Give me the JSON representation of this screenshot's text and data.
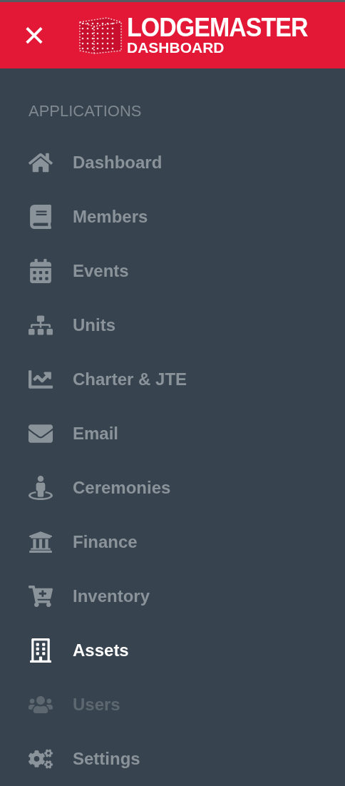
{
  "header": {
    "close": "×",
    "logo_title": "LODGEMASTER",
    "logo_subtitle": "DASHBOARD"
  },
  "sidebar": {
    "section": "APPLICATIONS",
    "items": [
      {
        "label": "Dashboard",
        "selected": false,
        "disabled": false
      },
      {
        "label": "Members",
        "selected": false,
        "disabled": false
      },
      {
        "label": "Events",
        "selected": false,
        "disabled": false
      },
      {
        "label": "Units",
        "selected": false,
        "disabled": false
      },
      {
        "label": "Charter & JTE",
        "selected": false,
        "disabled": false
      },
      {
        "label": "Email",
        "selected": false,
        "disabled": false
      },
      {
        "label": "Ceremonies",
        "selected": false,
        "disabled": false
      },
      {
        "label": "Finance",
        "selected": false,
        "disabled": false
      },
      {
        "label": "Inventory",
        "selected": false,
        "disabled": false
      },
      {
        "label": "Assets",
        "selected": true,
        "disabled": false
      },
      {
        "label": "Users",
        "selected": false,
        "disabled": true
      },
      {
        "label": "Settings",
        "selected": false,
        "disabled": false
      }
    ]
  }
}
